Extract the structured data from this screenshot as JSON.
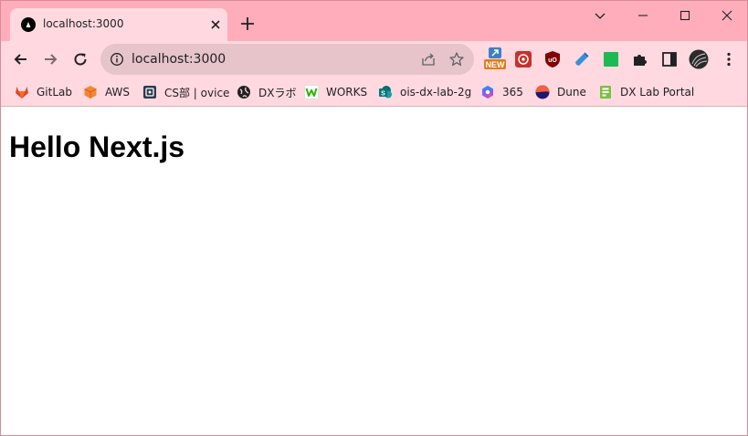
{
  "tab": {
    "title": "localhost:3000"
  },
  "omnibox": {
    "url": "localhost:3000"
  },
  "extensions": {
    "new_badge": "NEW"
  },
  "bookmarks": [
    {
      "label": "GitLab",
      "icon": "gitlab-icon"
    },
    {
      "label": "AWS",
      "icon": "aws-icon"
    },
    {
      "label": "CS部 | ovice",
      "icon": "ovice-icon"
    },
    {
      "label": "DXラボ",
      "icon": "globe-icon"
    },
    {
      "label": "WORKS",
      "icon": "works-icon"
    },
    {
      "label": "ois-dx-lab-2g",
      "icon": "sharepoint-icon"
    },
    {
      "label": "365",
      "icon": "office365-icon"
    },
    {
      "label": "Dune",
      "icon": "dune-icon"
    },
    {
      "label": "DX Lab Portal",
      "icon": "portal-icon"
    }
  ],
  "page": {
    "heading": "Hello Next.js"
  },
  "colors": {
    "frame": "#ffadbb",
    "toolbar": "#ffd9df",
    "omnibox": "#e6c4ca"
  }
}
